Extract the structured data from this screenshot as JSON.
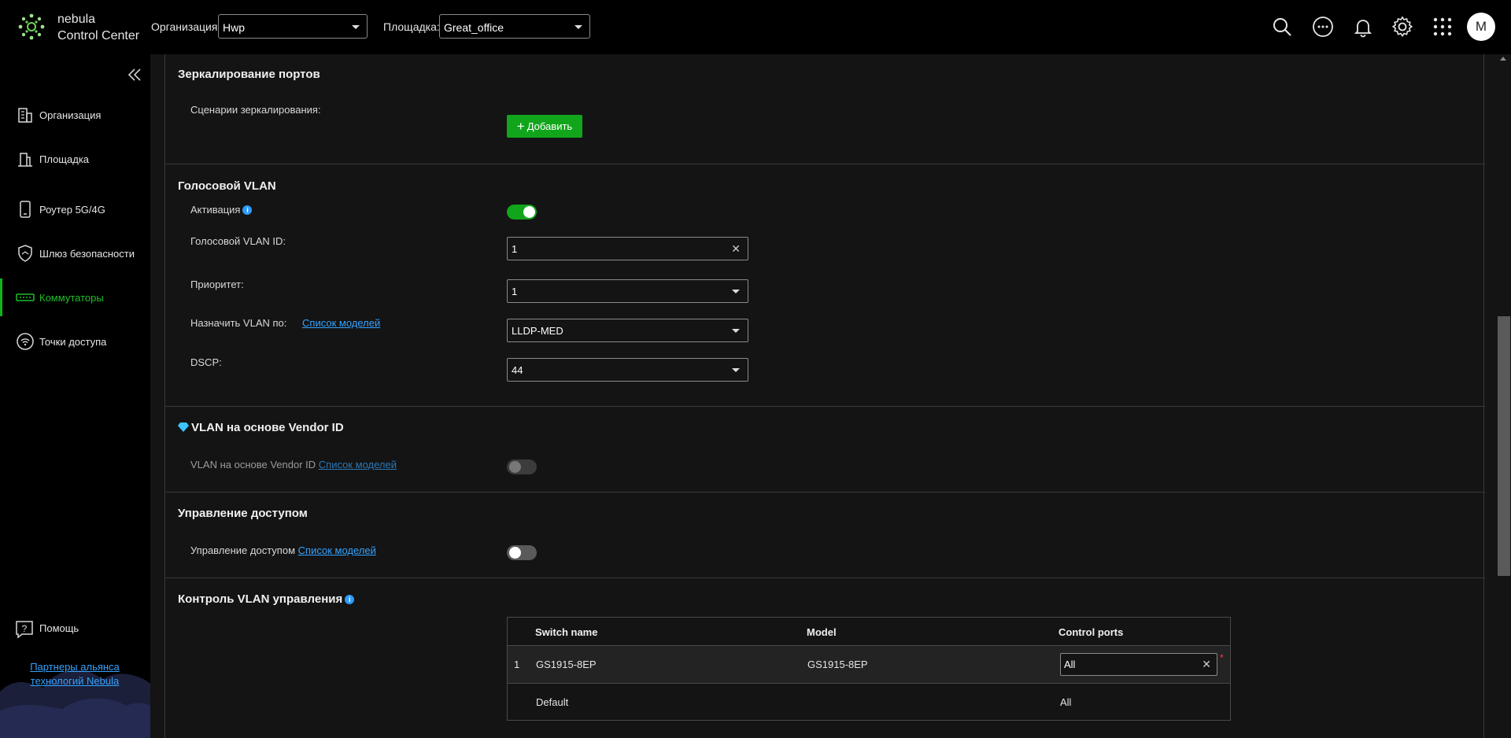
{
  "app": {
    "brand_line1": "nebula",
    "brand_line2": "Control Center"
  },
  "header": {
    "org_label": "Организация:",
    "org_value": "Hwp",
    "site_label": "Площадка:",
    "site_value": "Great_office",
    "avatar_letter": "M",
    "icons": [
      "search-icon",
      "more-icon",
      "bell-icon",
      "gear-icon",
      "apps-grid-icon"
    ]
  },
  "sidebar": {
    "items": [
      {
        "label": "Организация",
        "icon": "building-icon"
      },
      {
        "label": "Площадка",
        "icon": "site-icon"
      },
      {
        "label": "Роутер 5G/4G",
        "icon": "phone-icon"
      },
      {
        "label": "Шлюз безопасности",
        "icon": "shield-icon"
      },
      {
        "label": "Коммутаторы",
        "icon": "switch-icon",
        "active": true
      },
      {
        "label": "Точки доступа",
        "icon": "wifi-icon"
      }
    ],
    "help_label": "Помощь",
    "partner_link": "Партнеры альянса технологий Nebula"
  },
  "mirroring": {
    "title": "Зеркалирование портов",
    "scenarios_label": "Сценарии зеркалирования:",
    "add_button": "Добавить"
  },
  "voice_vlan": {
    "title": "Голосовой VLAN",
    "activation_label": "Активация",
    "activation_on": true,
    "vlan_id_label": "Голосовой VLAN ID:",
    "vlan_id_value": "1",
    "priority_label": "Приоритет:",
    "priority_value": "1",
    "assign_label": "Назначить VLAN по:",
    "model_list_link": "Список моделей",
    "assign_value": "LLDP-MED",
    "dscp_label": "DSCP:",
    "dscp_value": "44"
  },
  "vendor_vlan": {
    "title": "VLAN на основе Vendor ID",
    "row_label": "VLAN на основе Vendor ID",
    "model_list_link": "Список моделей",
    "enabled": false
  },
  "access_control": {
    "title": "Управление доступом",
    "row_label": "Управление доступом",
    "model_list_link": "Список моделей",
    "enabled": false
  },
  "mgmt_vlan": {
    "title": "Контроль VLAN управления",
    "columns": [
      "Switch name",
      "Model",
      "Control ports"
    ],
    "rows": [
      {
        "index": "1",
        "switch_name": "GS1915-8EP",
        "model": "GS1915-8EP",
        "control_ports": "All"
      }
    ],
    "default_row": {
      "name": "Default",
      "control_ports": "All"
    }
  },
  "colors": {
    "accent_green": "#11a51b",
    "link_blue": "#34a3ff",
    "background": "#141414"
  }
}
